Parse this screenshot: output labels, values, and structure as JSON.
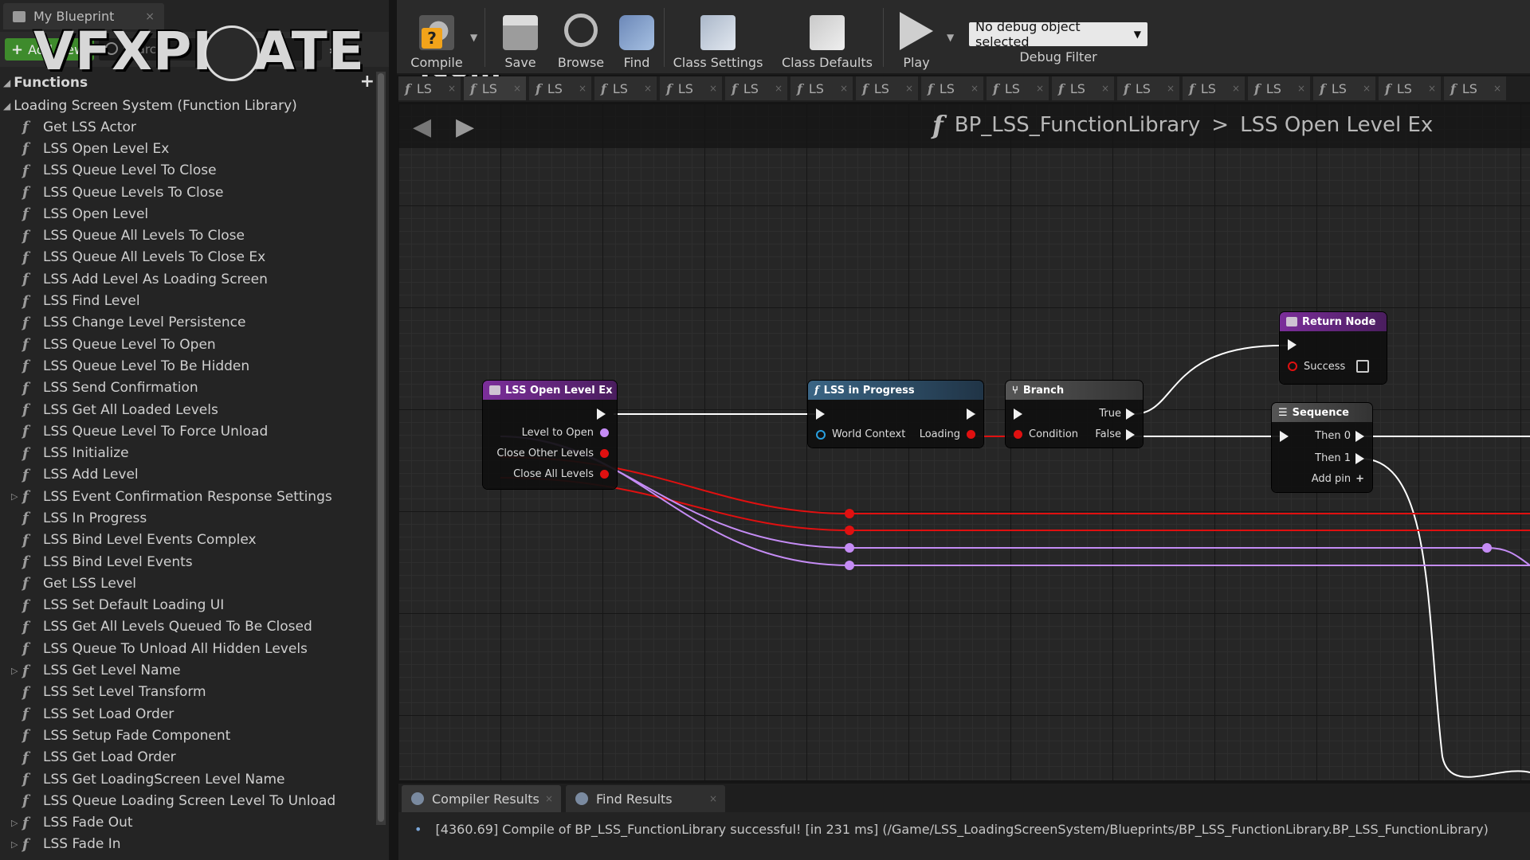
{
  "left_panel": {
    "tab_label": "My Blueprint",
    "add_new_label": "Add New",
    "search_placeholder": "Search",
    "functions_header": "Functions",
    "library_label": "Loading Screen System (Function Library)",
    "functions": [
      {
        "label": "Get LSS Actor",
        "expandable": false
      },
      {
        "label": "LSS Open Level Ex",
        "expandable": false
      },
      {
        "label": "LSS Queue Level To Close",
        "expandable": false
      },
      {
        "label": "LSS Queue Levels To Close",
        "expandable": false
      },
      {
        "label": "LSS Open Level",
        "expandable": false
      },
      {
        "label": "LSS Queue All Levels To Close",
        "expandable": false
      },
      {
        "label": "LSS Queue All Levels To Close Ex",
        "expandable": false
      },
      {
        "label": "LSS Add Level As Loading Screen",
        "expandable": false
      },
      {
        "label": "LSS Find Level",
        "expandable": false
      },
      {
        "label": "LSS Change Level Persistence",
        "expandable": false
      },
      {
        "label": "LSS Queue Level To Open",
        "expandable": false
      },
      {
        "label": "LSS Queue Level To Be Hidden",
        "expandable": false
      },
      {
        "label": "LSS Send Confirmation",
        "expandable": false
      },
      {
        "label": "LSS Get All Loaded Levels",
        "expandable": false
      },
      {
        "label": "LSS Queue Level To Force Unload",
        "expandable": false
      },
      {
        "label": "LSS Initialize",
        "expandable": false
      },
      {
        "label": "LSS Add Level",
        "expandable": false
      },
      {
        "label": "LSS Event Confirmation Response Settings",
        "expandable": true
      },
      {
        "label": "LSS In Progress",
        "expandable": false
      },
      {
        "label": "LSS Bind Level Events Complex",
        "expandable": false
      },
      {
        "label": "LSS Bind Level Events",
        "expandable": false
      },
      {
        "label": "Get LSS Level",
        "expandable": false
      },
      {
        "label": "LSS Set Default Loading UI",
        "expandable": false
      },
      {
        "label": "LSS Get All Levels Queued To Be Closed",
        "expandable": false
      },
      {
        "label": "LSS Queue To Unload All Hidden Levels",
        "expandable": false
      },
      {
        "label": "LSS Get Level Name",
        "expandable": true
      },
      {
        "label": "LSS Set Level Transform",
        "expandable": false
      },
      {
        "label": "LSS Set Load Order",
        "expandable": false
      },
      {
        "label": "LSS Setup Fade Component",
        "expandable": false
      },
      {
        "label": "LSS Get Load Order",
        "expandable": false
      },
      {
        "label": "LSS Get LoadingScreen Level Name",
        "expandable": false
      },
      {
        "label": "LSS Queue Loading Screen Level To Unload",
        "expandable": false
      },
      {
        "label": "LSS Fade Out",
        "expandable": true
      },
      {
        "label": "LSS Fade In",
        "expandable": true
      }
    ]
  },
  "watermark": {
    "text": "VFXPIRATE",
    "suffix": ".com"
  },
  "toolbar": {
    "compile_label": "Compile",
    "save_label": "Save",
    "browse_label": "Browse",
    "find_label": "Find",
    "class_settings_label": "Class Settings",
    "class_defaults_label": "Class Defaults",
    "play_label": "Play",
    "debug_select_value": "No debug object selected",
    "debug_filter_label": "Debug Filter"
  },
  "function_tabs": [
    "LS",
    "LS",
    "LS",
    "LS",
    "LS",
    "LS",
    "LS",
    "LS",
    "LS",
    "LS",
    "LS",
    "LS",
    "LS",
    "LS",
    "LS",
    "LS",
    "LS"
  ],
  "graph": {
    "breadcrumb_root": "BP_LSS_FunctionLibrary",
    "breadcrumb_separator": ">",
    "breadcrumb_current": "LSS Open Level Ex",
    "nodes": {
      "entry": {
        "title": "LSS Open Level Ex",
        "pins": [
          "Level to Open",
          "Close Other Levels",
          "Close All Levels"
        ]
      },
      "in_progress": {
        "title": "LSS in Progress",
        "world_context": "World Context",
        "loading": "Loading"
      },
      "branch": {
        "title": "Branch",
        "true_label": "True",
        "condition": "Condition",
        "false_label": "False"
      },
      "return": {
        "title": "Return Node",
        "success": "Success"
      },
      "sequence": {
        "title": "Sequence",
        "then0": "Then 0",
        "then1": "Then 1",
        "add_pin": "Add pin"
      }
    },
    "colors": {
      "function_header": "#6a2a84",
      "pure_header": "#3a5e7a",
      "flow_header": "#4b4b4b",
      "bool_pin": "#e01010",
      "name_pin": "#c58cf5",
      "exec_wire": "#ffffff"
    }
  },
  "bottom": {
    "compiler_tab": "Compiler Results",
    "find_tab": "Find Results",
    "log_message": "[4360.69] Compile of BP_LSS_FunctionLibrary successful! [in 231 ms] (/Game/LSS_LoadingScreenSystem/Blueprints/BP_LSS_FunctionLibrary.BP_LSS_FunctionLibrary)"
  }
}
